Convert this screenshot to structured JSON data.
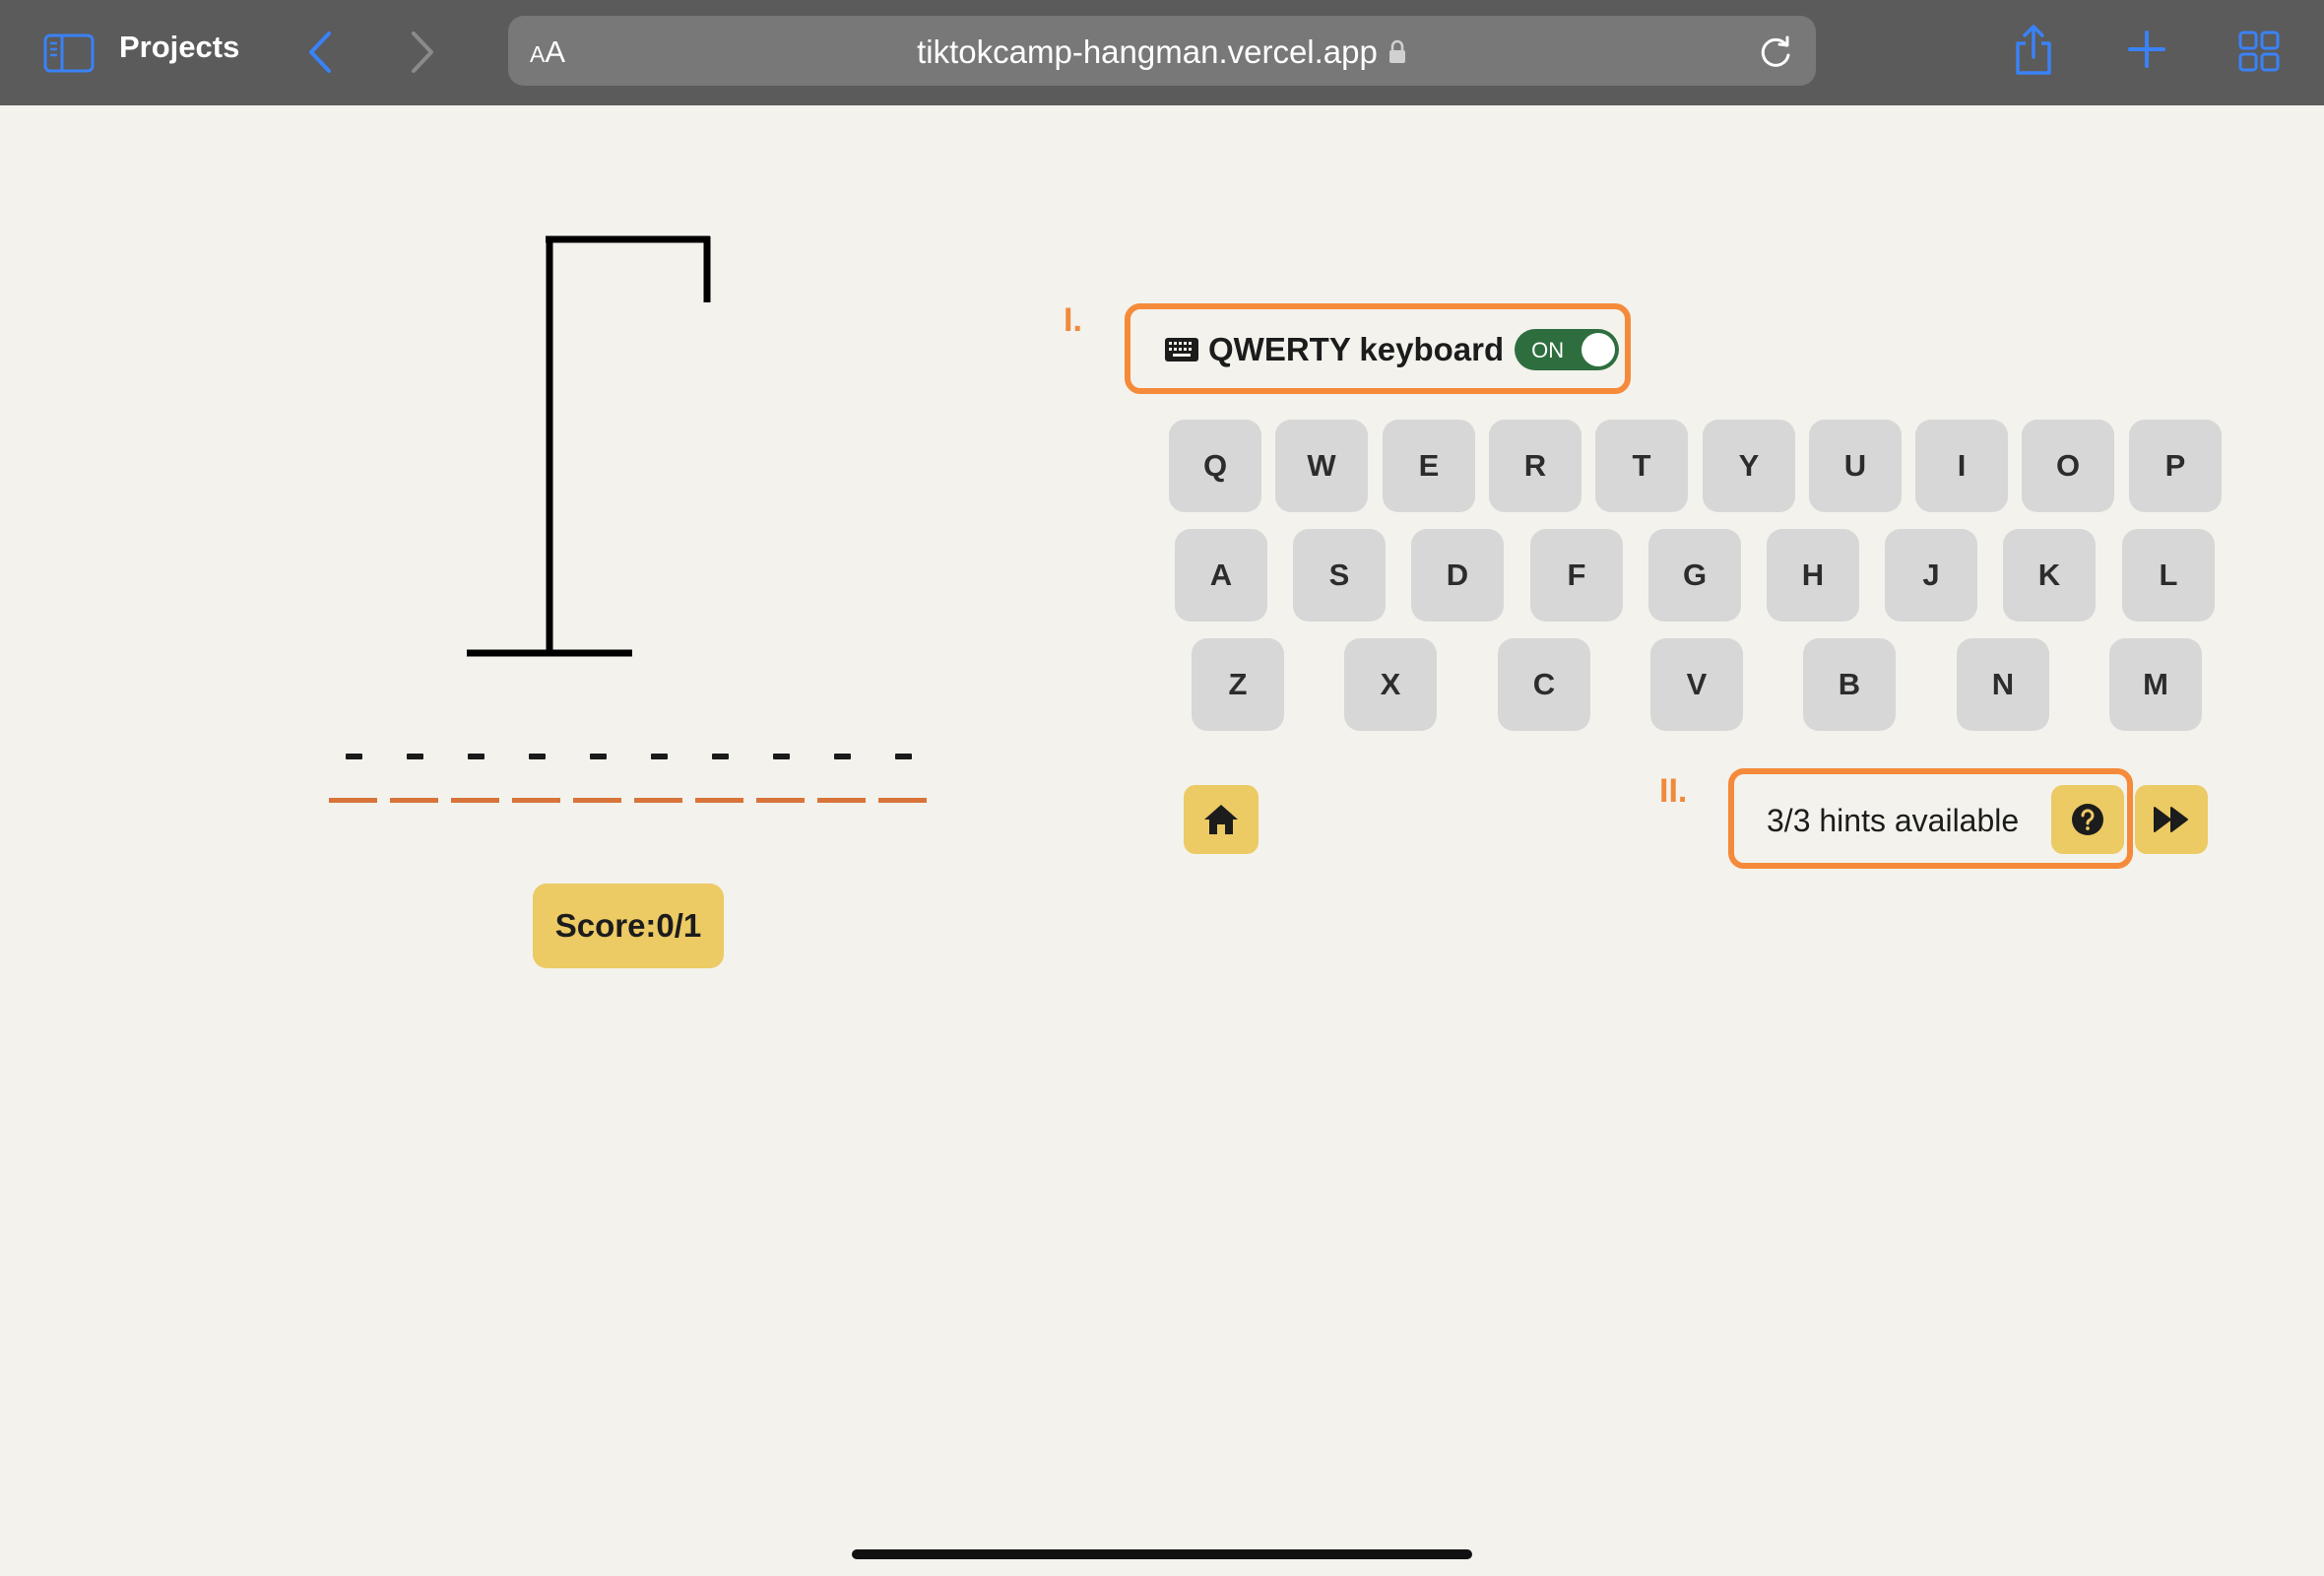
{
  "browser": {
    "sidebar_label": "Projects",
    "aa_label_small": "A",
    "aa_label_large": "A",
    "url": "tiktokcamp-hangman.vercel.app",
    "accent_color": "#3a82f7"
  },
  "game": {
    "markers": {
      "first": "I.",
      "second": "II."
    },
    "keyboard_toggle": {
      "label": "QWERTY keyboard",
      "state": "ON"
    },
    "keyboard_rows": [
      [
        "Q",
        "W",
        "E",
        "R",
        "T",
        "Y",
        "U",
        "I",
        "O",
        "P"
      ],
      [
        "A",
        "S",
        "D",
        "F",
        "G",
        "H",
        "J",
        "K",
        "L"
      ],
      [
        "Z",
        "X",
        "C",
        "V",
        "B",
        "N",
        "M"
      ]
    ],
    "word_slots": 10,
    "score": "Score:0/1",
    "hints_text": "3/3 hints available",
    "highlight_color": "#f58a3a",
    "button_color": "#ecca64"
  }
}
